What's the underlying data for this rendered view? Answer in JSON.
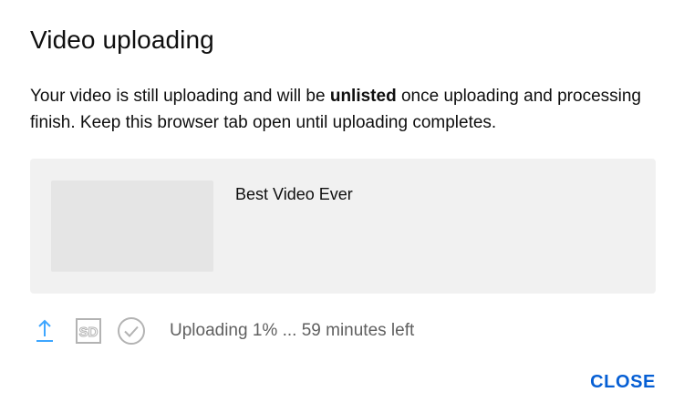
{
  "dialog": {
    "title": "Video uploading",
    "message_part1": "Your video is still uploading and will be ",
    "message_bold": "unlisted",
    "message_part2": " once uploading and processing finish. Keep this browser tab open until uploading completes."
  },
  "video": {
    "title": "Best Video Ever"
  },
  "status": {
    "text": "Uploading 1% ... 59 minutes left",
    "progress_percent": 1,
    "sd_label": "SD",
    "icons": [
      "upload-arrow-icon",
      "sd-quality-icon",
      "check-circle-icon"
    ],
    "upload_icon_color": "#3ea6ff",
    "inactive_icon_color": "#b3b3b3"
  },
  "actions": {
    "close_label": "CLOSE",
    "close_color": "#065fd4"
  }
}
